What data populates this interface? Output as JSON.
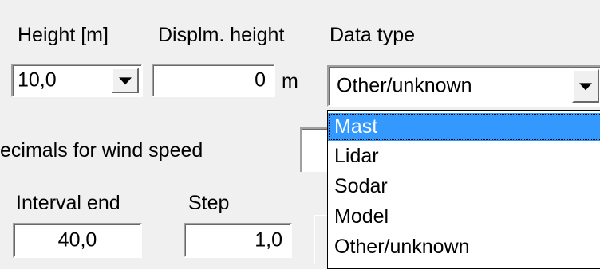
{
  "labels": {
    "height": "Height [m]",
    "displ_height": "Displm. height",
    "data_type": "Data type",
    "decimals_wind_speed": "ecimals for wind speed",
    "interval_end": "Interval end",
    "step": "Step"
  },
  "height_combo": {
    "value": "10,0",
    "icon": "chevron-down-icon"
  },
  "displ_height_field": {
    "value": "0",
    "unit": "m"
  },
  "data_type_combo": {
    "value": "Other/unknown",
    "icon": "chevron-down-icon"
  },
  "data_type_options": [
    {
      "label": "Mast",
      "selected": true
    },
    {
      "label": "Lidar",
      "selected": false
    },
    {
      "label": "Sodar",
      "selected": false
    },
    {
      "label": "Model",
      "selected": false
    },
    {
      "label": "Other/unknown",
      "selected": false
    }
  ],
  "interval_end_field": {
    "value": "40,0"
  },
  "step_field": {
    "value": "1,0"
  },
  "colors": {
    "selection_highlight": "#3399ff",
    "window_background": "#f0f0f0",
    "field_background": "#ffffff"
  }
}
